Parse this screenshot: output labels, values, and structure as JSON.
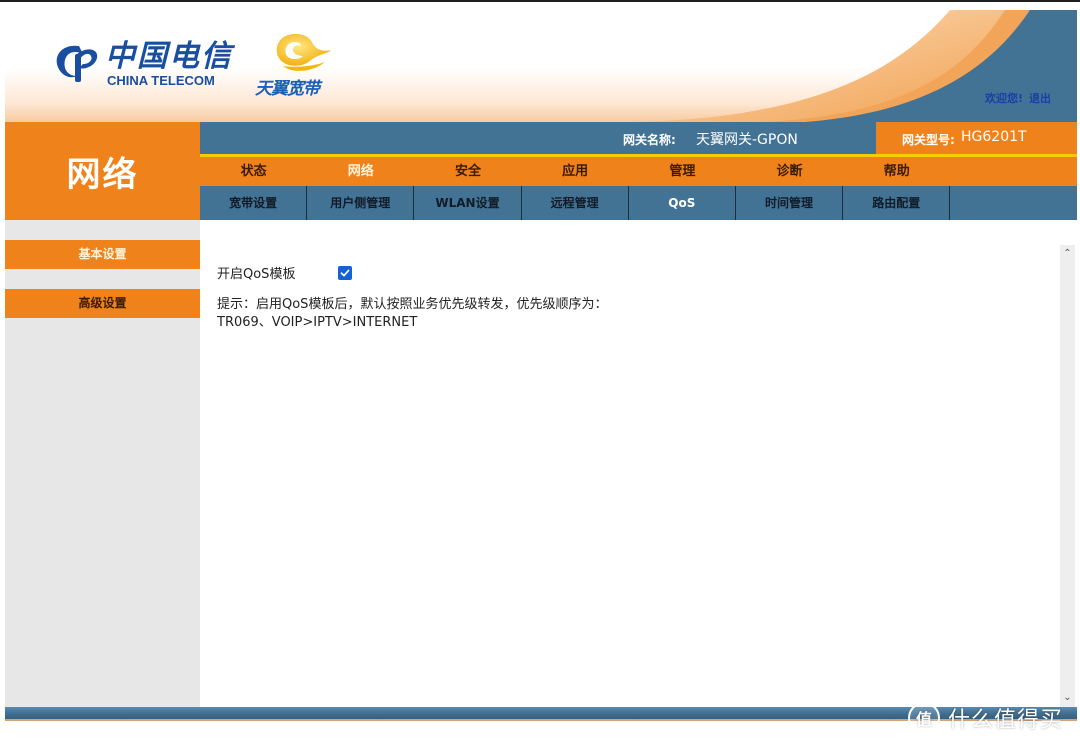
{
  "header": {
    "logo_cn": "中国电信",
    "logo_en": "CHINA TELECOM",
    "brand_text": "天翼宽带",
    "welcome": "欢迎您!",
    "logout": "退出"
  },
  "section_title": "网络",
  "infobar": {
    "gateway_name_label": "网关名称:",
    "gateway_name_value": "天翼网关-GPON",
    "gateway_model_label": "网关型号:",
    "gateway_model_value": "HG6201T"
  },
  "main_nav": [
    {
      "label": "状态",
      "active": false
    },
    {
      "label": "网络",
      "active": true
    },
    {
      "label": "安全",
      "active": false
    },
    {
      "label": "应用",
      "active": false
    },
    {
      "label": "管理",
      "active": false
    },
    {
      "label": "诊断",
      "active": false
    },
    {
      "label": "帮助",
      "active": false
    }
  ],
  "sub_nav": [
    {
      "label": "宽带设置",
      "active": false
    },
    {
      "label": "用户侧管理",
      "active": false
    },
    {
      "label": "WLAN设置",
      "active": false
    },
    {
      "label": "远程管理",
      "active": false
    },
    {
      "label": "QoS",
      "active": true
    },
    {
      "label": "时间管理",
      "active": false
    },
    {
      "label": "路由配置",
      "active": false
    }
  ],
  "sidebar": {
    "items": [
      {
        "label": "基本设置",
        "active": true
      },
      {
        "label": "高级设置",
        "active": false
      }
    ]
  },
  "content": {
    "qos_template_label": "开启QoS模板",
    "qos_template_checked": true,
    "hint_line1": "提示：启用QoS模板后，默认按照业务优先级转发，优先级顺序为：",
    "hint_line2": "TR069、VOIP>IPTV>INTERNET"
  },
  "watermark": {
    "badge": "值",
    "text": "什么值得买"
  },
  "colors": {
    "orange": "#f0821c",
    "steel_blue": "#437394",
    "yellow_accent": "#f7cc00",
    "link_blue": "#1a3ea8",
    "checkbox_blue": "#1463d2"
  }
}
